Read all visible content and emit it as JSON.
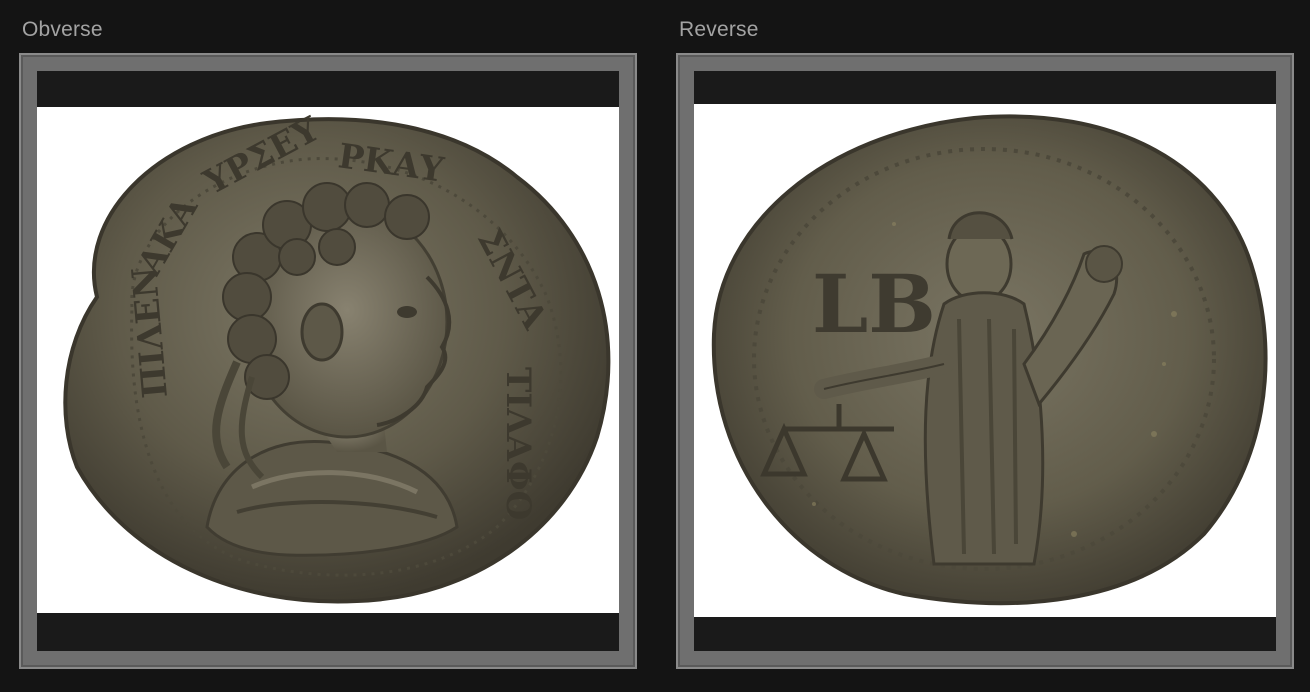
{
  "obverse": {
    "title": "Obverse",
    "image_label": "obverse coin photo"
  },
  "reverse": {
    "title": "Reverse",
    "image_label": "reverse coin photo"
  },
  "colors": {
    "background": "#141414",
    "frame": "#6f6f6f",
    "title": "#a3a3a3",
    "coin_dark": "#4a4638",
    "coin_mid": "#6b6654",
    "coin_light": "#8a8470"
  }
}
